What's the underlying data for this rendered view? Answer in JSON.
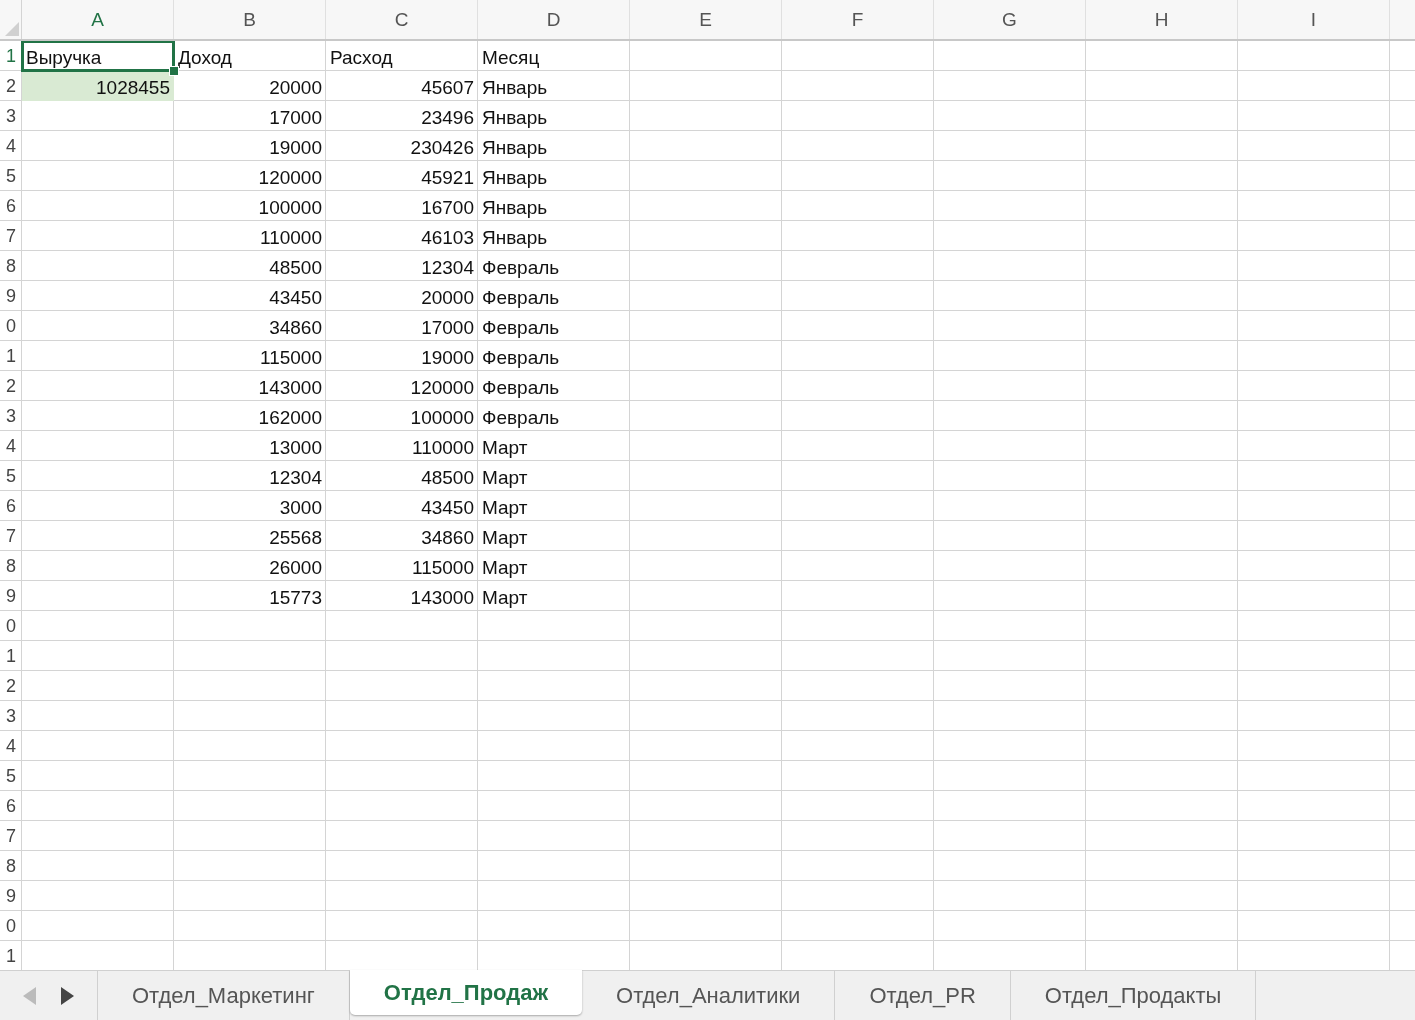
{
  "columns": [
    {
      "label": "A",
      "selected": true
    },
    {
      "label": "B",
      "selected": false
    },
    {
      "label": "C",
      "selected": false
    },
    {
      "label": "D",
      "selected": false
    },
    {
      "label": "E",
      "selected": false
    },
    {
      "label": "F",
      "selected": false
    },
    {
      "label": "G",
      "selected": false
    },
    {
      "label": "H",
      "selected": false
    },
    {
      "label": "I",
      "selected": false
    }
  ],
  "rows": [
    {
      "number": "1",
      "selected": true,
      "cells": [
        {
          "text": "Выручка",
          "kind": "text"
        },
        {
          "text": "Доход",
          "kind": "text"
        },
        {
          "text": "Расход",
          "kind": "text"
        },
        {
          "text": "Месяц",
          "kind": "text"
        }
      ]
    },
    {
      "number": "2",
      "selected": false,
      "cells": [
        {
          "text": "1028455",
          "kind": "number",
          "highlighted": true
        },
        {
          "text": "20000",
          "kind": "number"
        },
        {
          "text": "45607",
          "kind": "number"
        },
        {
          "text": "Январь",
          "kind": "text"
        }
      ]
    },
    {
      "number": "3",
      "selected": false,
      "cells": [
        {
          "kind": "empty"
        },
        {
          "text": "17000",
          "kind": "number"
        },
        {
          "text": "23496",
          "kind": "number"
        },
        {
          "text": "Январь",
          "kind": "text"
        }
      ]
    },
    {
      "number": "4",
      "selected": false,
      "cells": [
        {
          "kind": "empty"
        },
        {
          "text": "19000",
          "kind": "number"
        },
        {
          "text": "230426",
          "kind": "number"
        },
        {
          "text": "Январь",
          "kind": "text"
        }
      ]
    },
    {
      "number": "5",
      "selected": false,
      "cells": [
        {
          "kind": "empty"
        },
        {
          "text": "120000",
          "kind": "number"
        },
        {
          "text": "45921",
          "kind": "number"
        },
        {
          "text": "Январь",
          "kind": "text"
        }
      ]
    },
    {
      "number": "6",
      "selected": false,
      "cells": [
        {
          "kind": "empty"
        },
        {
          "text": "100000",
          "kind": "number"
        },
        {
          "text": "16700",
          "kind": "number"
        },
        {
          "text": "Январь",
          "kind": "text"
        }
      ]
    },
    {
      "number": "7",
      "selected": false,
      "cells": [
        {
          "kind": "empty"
        },
        {
          "text": "110000",
          "kind": "number"
        },
        {
          "text": "46103",
          "kind": "number"
        },
        {
          "text": "Январь",
          "kind": "text"
        }
      ]
    },
    {
      "number": "8",
      "selected": false,
      "cells": [
        {
          "kind": "empty"
        },
        {
          "text": "48500",
          "kind": "number"
        },
        {
          "text": "12304",
          "kind": "number"
        },
        {
          "text": "Февраль",
          "kind": "text"
        }
      ]
    },
    {
      "number": "9",
      "selected": false,
      "cells": [
        {
          "kind": "empty"
        },
        {
          "text": "43450",
          "kind": "number"
        },
        {
          "text": "20000",
          "kind": "number"
        },
        {
          "text": "Февраль",
          "kind": "text"
        }
      ]
    },
    {
      "number": "0",
      "selected": false,
      "cells": [
        {
          "kind": "empty"
        },
        {
          "text": "34860",
          "kind": "number"
        },
        {
          "text": "17000",
          "kind": "number"
        },
        {
          "text": "Февраль",
          "kind": "text"
        }
      ]
    },
    {
      "number": "1",
      "selected": false,
      "cells": [
        {
          "kind": "empty"
        },
        {
          "text": "115000",
          "kind": "number"
        },
        {
          "text": "19000",
          "kind": "number"
        },
        {
          "text": "Февраль",
          "kind": "text"
        }
      ]
    },
    {
      "number": "2",
      "selected": false,
      "cells": [
        {
          "kind": "empty"
        },
        {
          "text": "143000",
          "kind": "number"
        },
        {
          "text": "120000",
          "kind": "number"
        },
        {
          "text": "Февраль",
          "kind": "text"
        }
      ]
    },
    {
      "number": "3",
      "selected": false,
      "cells": [
        {
          "kind": "empty"
        },
        {
          "text": "162000",
          "kind": "number"
        },
        {
          "text": "100000",
          "kind": "number"
        },
        {
          "text": "Февраль",
          "kind": "text"
        }
      ]
    },
    {
      "number": "4",
      "selected": false,
      "cells": [
        {
          "kind": "empty"
        },
        {
          "text": "13000",
          "kind": "number"
        },
        {
          "text": "110000",
          "kind": "number"
        },
        {
          "text": "Март",
          "kind": "text"
        }
      ]
    },
    {
      "number": "5",
      "selected": false,
      "cells": [
        {
          "kind": "empty"
        },
        {
          "text": "12304",
          "kind": "number"
        },
        {
          "text": "48500",
          "kind": "number"
        },
        {
          "text": "Март",
          "kind": "text"
        }
      ]
    },
    {
      "number": "6",
      "selected": false,
      "cells": [
        {
          "kind": "empty"
        },
        {
          "text": "3000",
          "kind": "number"
        },
        {
          "text": "43450",
          "kind": "number"
        },
        {
          "text": "Март",
          "kind": "text"
        }
      ]
    },
    {
      "number": "7",
      "selected": false,
      "cells": [
        {
          "kind": "empty"
        },
        {
          "text": "25568",
          "kind": "number"
        },
        {
          "text": "34860",
          "kind": "number"
        },
        {
          "text": "Март",
          "kind": "text"
        }
      ]
    },
    {
      "number": "8",
      "selected": false,
      "cells": [
        {
          "kind": "empty"
        },
        {
          "text": "26000",
          "kind": "number"
        },
        {
          "text": "115000",
          "kind": "number"
        },
        {
          "text": "Март",
          "kind": "text"
        }
      ]
    },
    {
      "number": "9",
      "selected": false,
      "cells": [
        {
          "kind": "empty"
        },
        {
          "text": "15773",
          "kind": "number"
        },
        {
          "text": "143000",
          "kind": "number"
        },
        {
          "text": "Март",
          "kind": "text"
        }
      ]
    },
    {
      "number": "0",
      "selected": false
    },
    {
      "number": "1",
      "selected": false
    },
    {
      "number": "2",
      "selected": false
    },
    {
      "number": "3",
      "selected": false
    },
    {
      "number": "4",
      "selected": false
    },
    {
      "number": "5",
      "selected": false
    },
    {
      "number": "6",
      "selected": false
    },
    {
      "number": "7",
      "selected": false
    },
    {
      "number": "8",
      "selected": false
    },
    {
      "number": "9",
      "selected": false
    },
    {
      "number": "0",
      "selected": false
    },
    {
      "number": "1",
      "selected": false
    }
  ],
  "sheet_nav": {
    "previous_disabled": true,
    "next_disabled": false
  },
  "sheet_tabs": [
    {
      "label": "Отдел_Маркетинг",
      "selected": false
    },
    {
      "label": "Отдел_Продаж",
      "selected": true
    },
    {
      "label": "Отдел_Аналитики",
      "selected": false
    },
    {
      "label": "Отдел_PR",
      "selected": false
    },
    {
      "label": "Отдел_Продакты",
      "selected": false
    }
  ]
}
